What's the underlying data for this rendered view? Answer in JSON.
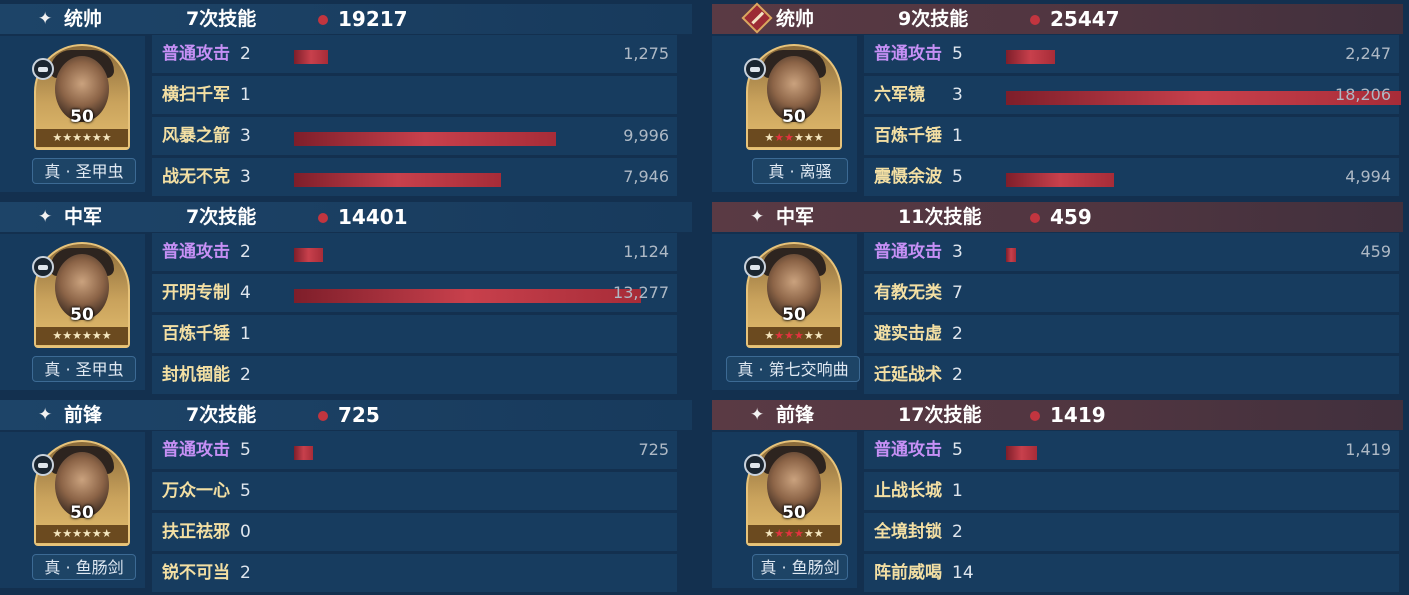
{
  "colors": {
    "bar": "#c8404c",
    "basic_attack": "#c690f5",
    "skill_name": "#f3dfa3",
    "dot": "#c2353f"
  },
  "left": [
    {
      "role": "统帅",
      "count": "7次技能",
      "total": "19217",
      "level": "50",
      "gear": "真 · 圣甲虫",
      "red_stars": 0,
      "skills": [
        {
          "name": "普通攻击",
          "count": "2",
          "value": "1,275",
          "ratio": 0.055,
          "basic": true
        },
        {
          "name": "横扫千军",
          "count": "1",
          "value": "",
          "ratio": 0
        },
        {
          "name": "风暴之箭",
          "count": "3",
          "value": "9,996",
          "ratio": 0.43
        },
        {
          "name": "战无不克",
          "count": "3",
          "value": "7,946",
          "ratio": 0.34
        }
      ]
    },
    {
      "role": "中军",
      "count": "7次技能",
      "total": "14401",
      "level": "50",
      "gear": "真 · 圣甲虫",
      "red_stars": 0,
      "skills": [
        {
          "name": "普通攻击",
          "count": "2",
          "value": "1,124",
          "ratio": 0.048,
          "basic": true
        },
        {
          "name": "开明专制",
          "count": "4",
          "value": "13,277",
          "ratio": 0.57
        },
        {
          "name": "百炼千锤",
          "count": "1",
          "value": "",
          "ratio": 0
        },
        {
          "name": "封机锢能",
          "count": "2",
          "value": "",
          "ratio": 0
        }
      ]
    },
    {
      "role": "前锋",
      "count": "7次技能",
      "total": "725",
      "level": "50",
      "gear": "真 · 鱼肠剑",
      "red_stars": 0,
      "skills": [
        {
          "name": "普通攻击",
          "count": "5",
          "value": "725",
          "ratio": 0.031,
          "basic": true
        },
        {
          "name": "万众一心",
          "count": "5",
          "value": "",
          "ratio": 0
        },
        {
          "name": "扶正祛邪",
          "count": "0",
          "value": "",
          "ratio": 0
        },
        {
          "name": "锐不可当",
          "count": "2",
          "value": "",
          "ratio": 0
        }
      ]
    }
  ],
  "right": [
    {
      "role": "统帅",
      "count": "9次技能",
      "total": "25447",
      "level": "50",
      "gear": "真 · 离骚",
      "red_stars": 2,
      "skills": [
        {
          "name": "普通攻击",
          "count": "5",
          "value": "2,247",
          "ratio": 0.079,
          "basic": true
        },
        {
          "name": "六军镜",
          "count": "3",
          "value": "18,206",
          "ratio": 0.64
        },
        {
          "name": "百炼千锤",
          "count": "1",
          "value": "",
          "ratio": 0
        },
        {
          "name": "震慑余波",
          "count": "5",
          "value": "4,994",
          "ratio": 0.175
        }
      ]
    },
    {
      "role": "中军",
      "count": "11次技能",
      "total": "459",
      "level": "50",
      "gear": "真 · 第七交响曲",
      "red_stars": 3,
      "skills": [
        {
          "name": "普通攻击",
          "count": "3",
          "value": "459",
          "ratio": 0.016,
          "basic": true
        },
        {
          "name": "有教无类",
          "count": "7",
          "value": "",
          "ratio": 0
        },
        {
          "name": "避实击虚",
          "count": "2",
          "value": "",
          "ratio": 0
        },
        {
          "name": "迁延战术",
          "count": "2",
          "value": "",
          "ratio": 0
        }
      ]
    },
    {
      "role": "前锋",
      "count": "17次技能",
      "total": "1419",
      "level": "50",
      "gear": "真 · 鱼肠剑",
      "red_stars": 3,
      "skills": [
        {
          "name": "普通攻击",
          "count": "5",
          "value": "1,419",
          "ratio": 0.05,
          "basic": true
        },
        {
          "name": "止战长城",
          "count": "1",
          "value": "",
          "ratio": 0
        },
        {
          "name": "全境封锁",
          "count": "2",
          "value": "",
          "ratio": 0
        },
        {
          "name": "阵前威喝",
          "count": "14",
          "value": "",
          "ratio": 0
        }
      ]
    }
  ]
}
